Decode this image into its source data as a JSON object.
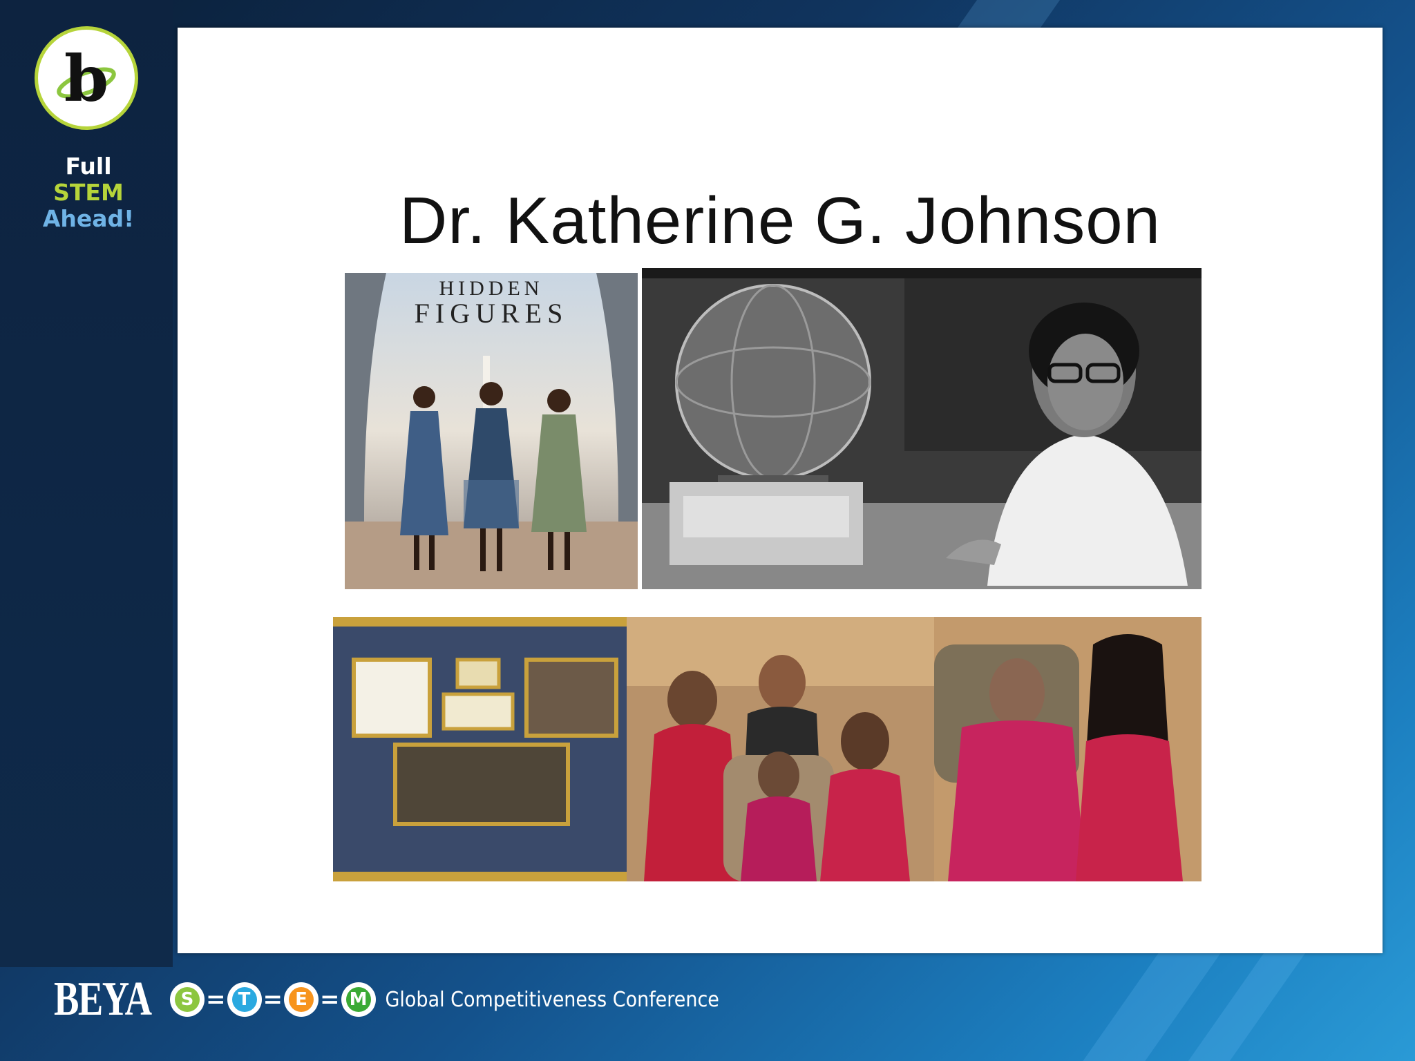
{
  "sidebar": {
    "logo_letter": "b",
    "tagline_line1": "Full",
    "tagline_line2": "STEM",
    "tagline_line3": "Ahead!"
  },
  "slide": {
    "title": "Dr. Katherine G. Johnson",
    "poster": {
      "line1": "HIDDEN",
      "line2": "FIGURES"
    }
  },
  "footer": {
    "brand": "BEYA",
    "stem_letters": [
      "S",
      "T",
      "E",
      "M"
    ],
    "stem_colors": [
      "#8cc63f",
      "#2aa9e0",
      "#f7941d",
      "#3aaa35"
    ],
    "conference": "Global Competitiveness Conference"
  },
  "colors": {
    "accent_green": "#b6d43a",
    "accent_blue": "#6fb3e6",
    "slide_bg": "#ffffff"
  }
}
